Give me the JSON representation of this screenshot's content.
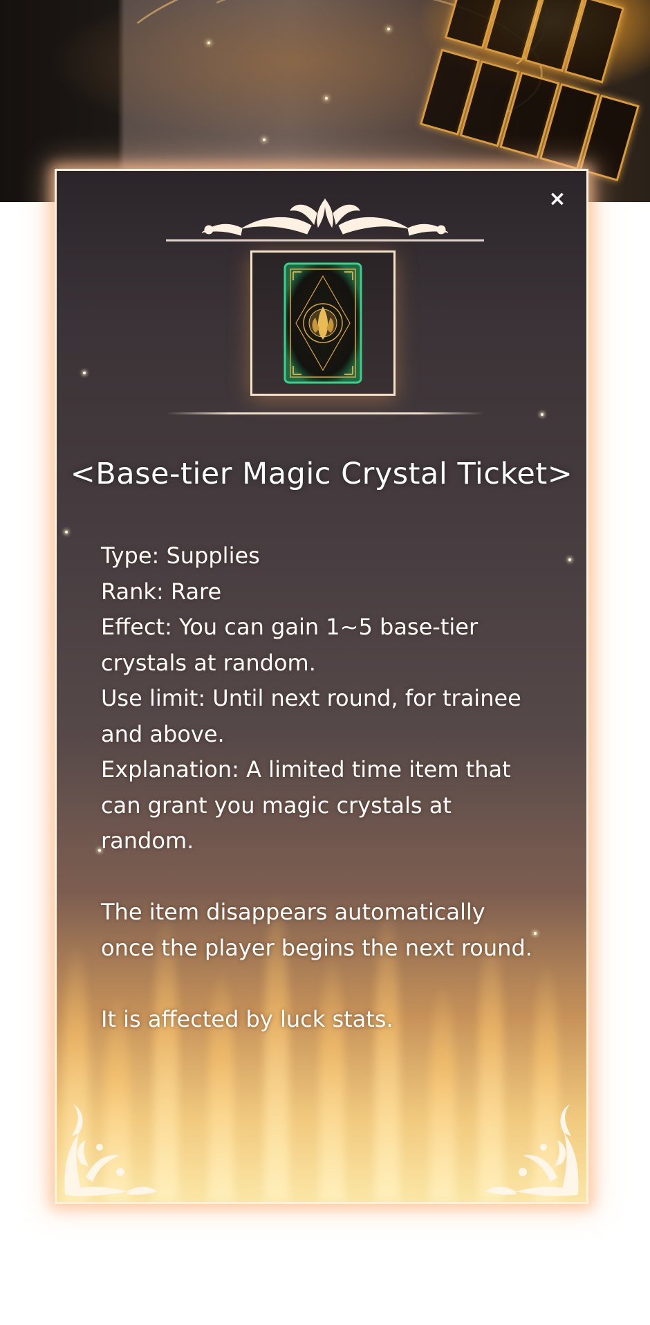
{
  "panel": {
    "close_label": "×",
    "title": "<Base-tier Magic Crystal Ticket>",
    "description_lines": {
      "type": "Type: Supplies",
      "rank": "Rank: Rare",
      "effect_1": "Effect: You can gain 1~5 base-tier",
      "effect_2": "crystals at random.",
      "limit_1": "Use limit: Until next round, for trainee",
      "limit_2": "and above.",
      "explanation_1": "Explanation: A limited time item that",
      "explanation_2": "can grant you magic crystals at",
      "explanation_3": "random.",
      "note_1": "The item disappears automatically",
      "note_2": "once the player begins the next round.",
      "luck": "It is affected by luck stats."
    }
  },
  "icons": {
    "close": "close-icon",
    "item": "card-icon",
    "ornaments": [
      "ornament-top-icon",
      "corner-ornament-left-icon",
      "corner-ornament-right-icon"
    ]
  },
  "colors": {
    "text": "#ffffff",
    "panel_border": "#fff3df",
    "card_glow": "#39d08a",
    "gold": "#d9a441"
  }
}
